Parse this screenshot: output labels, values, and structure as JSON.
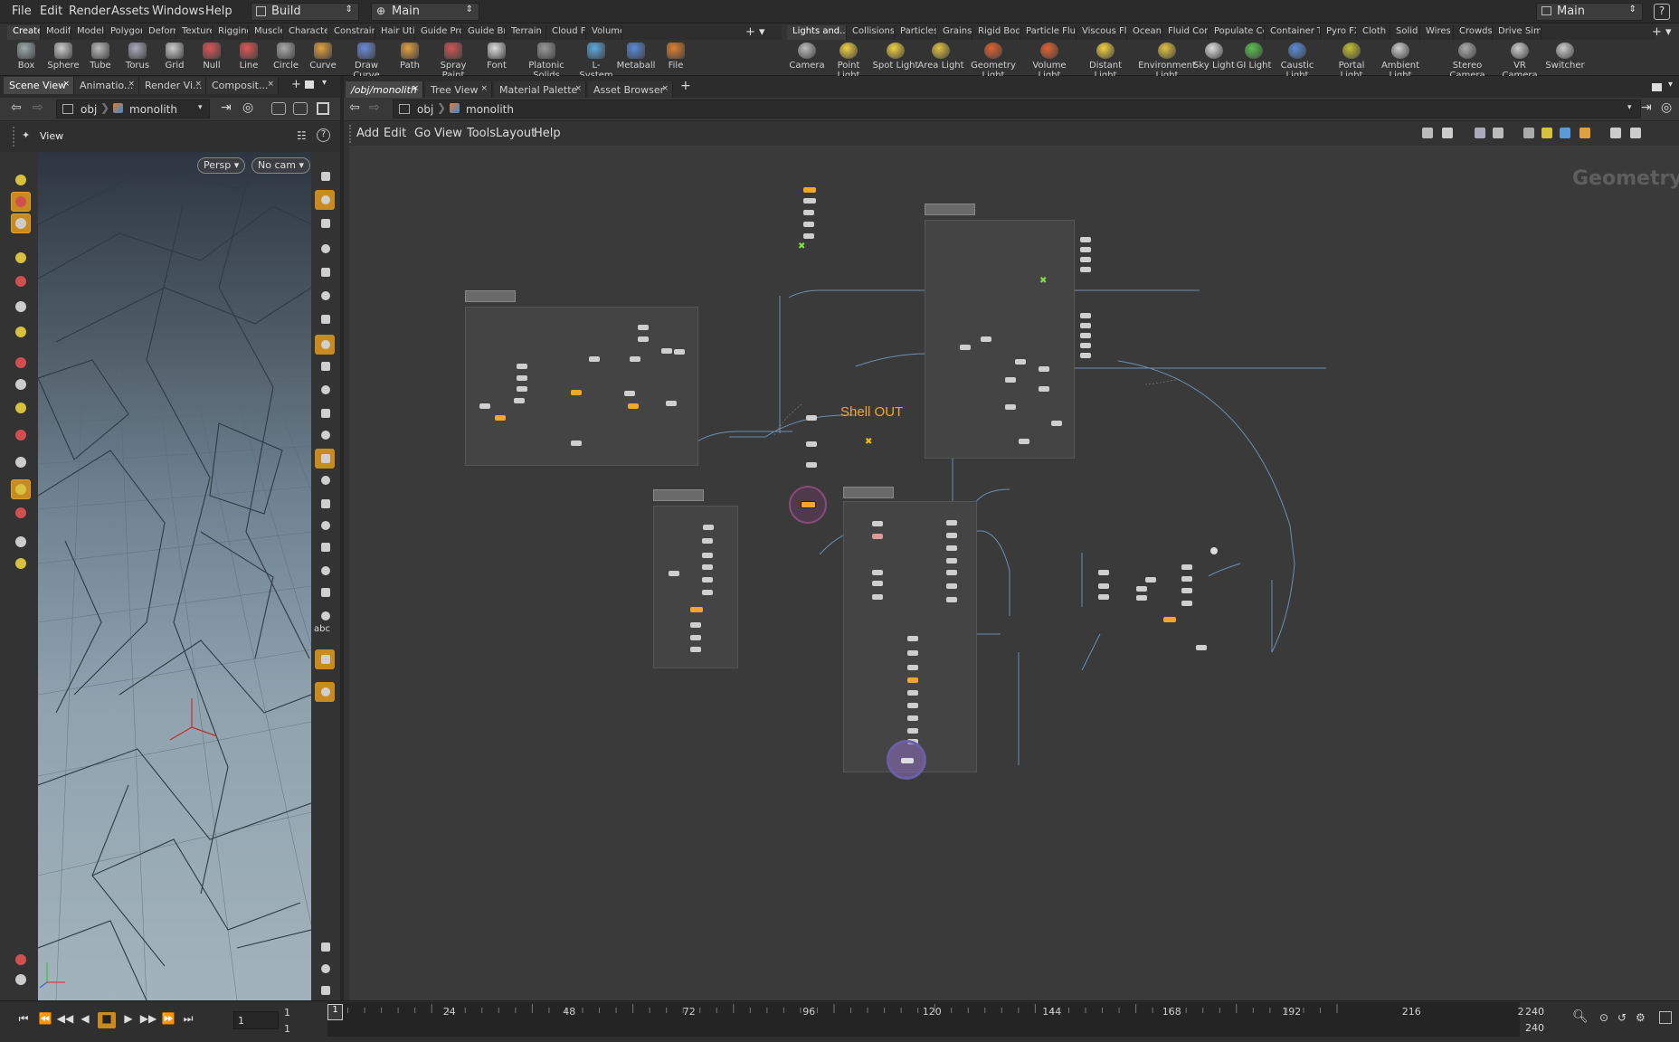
{
  "menubar": {
    "items": [
      "File",
      "Edit",
      "Render",
      "Assets",
      "Windows",
      "Help"
    ],
    "desktop": "Build",
    "context": "Main",
    "right_context": "Main"
  },
  "shelf_left": {
    "tabs": [
      "Create",
      "Modify",
      "Model",
      "Polygon",
      "Deform",
      "Texture",
      "Rigging",
      "Muscles",
      "Characters",
      "Constraints",
      "Hair Utils",
      "Guide Pro...",
      "Guide Bru...",
      "Terrain FX",
      "Cloud FX",
      "Volume"
    ],
    "tools": [
      "Box",
      "Sphere",
      "Tube",
      "Torus",
      "Grid",
      "Null",
      "Line",
      "Circle",
      "Curve",
      "Draw Curve",
      "Path",
      "Spray Paint",
      "Font",
      "Platonic Solids",
      "L-System",
      "Metaball",
      "File"
    ]
  },
  "shelf_right": {
    "tabs": [
      "Lights and...",
      "Collisions",
      "Particles",
      "Grains",
      "Rigid Bodies",
      "Particle Fluids",
      "Viscous Flu...",
      "Oceans",
      "Fluid Cont...",
      "Populate Co...",
      "Container T...",
      "Pyro FX",
      "Cloth",
      "Solid",
      "Wires",
      "Crowds",
      "Drive Simu..."
    ],
    "tools": [
      "Camera",
      "Point Light",
      "Spot Light",
      "Area Light",
      "Geometry Light",
      "Volume Light",
      "Distant Light",
      "Environment Light",
      "Sky Light",
      "GI Light",
      "Caustic Light",
      "Portal Light",
      "Ambient Light",
      "Stereo Camera",
      "VR Camera",
      "Switcher"
    ]
  },
  "left_pane": {
    "tabs": [
      "Scene View",
      "Animatio...",
      "Render Vi...",
      "Composit..."
    ],
    "path_root": "obj",
    "path_node": "monolith",
    "viewer_label": "View",
    "persp": "Persp",
    "cam": "No cam",
    "abc": "abc"
  },
  "network_pane": {
    "tabs": [
      "/obj/monolith",
      "Tree View",
      "Material Palette",
      "Asset Browser"
    ],
    "path_root": "obj",
    "path_node": "monolith",
    "menu": [
      "Add",
      "Edit",
      "Go",
      "View",
      "Tools",
      "Layout",
      "Help"
    ],
    "context_label": "Geometry",
    "sticky_note": "Shell OUT"
  },
  "timeline": {
    "frame": "1",
    "start": "1",
    "start2": "1",
    "end": "240",
    "end2": "240",
    "ticks": [
      "1",
      "24",
      "48",
      "72",
      "96",
      "120",
      "144",
      "168",
      "192",
      "216",
      "2"
    ]
  },
  "colors": {
    "accent": "#f2a72c",
    "node": "#cfcfcf",
    "wire": "#6e8fb0",
    "network_bg": "#3a3a3a"
  }
}
